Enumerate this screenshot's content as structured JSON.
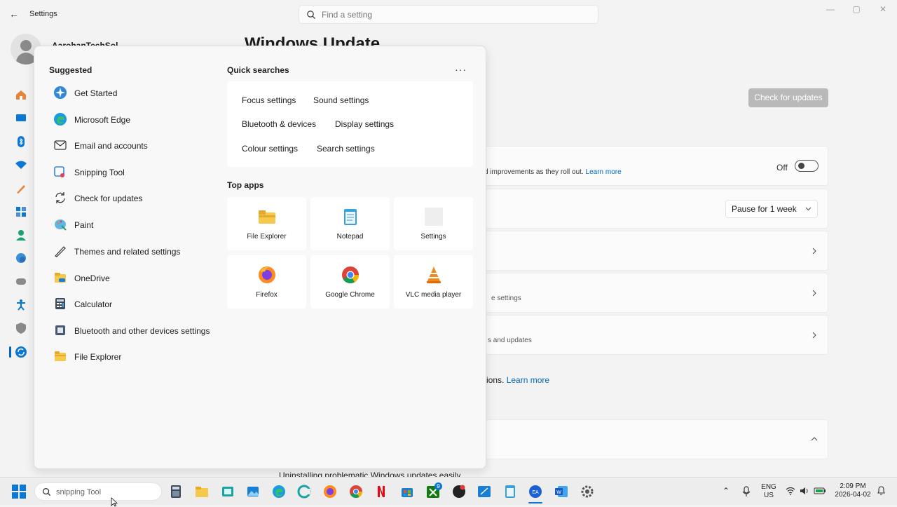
{
  "app": {
    "title": "Settings"
  },
  "search": {
    "placeholder": "Find a setting"
  },
  "account": {
    "name": "AarohanTechSol"
  },
  "page": {
    "title": "Windows Update"
  },
  "main": {
    "check_button": "Check for updates",
    "card1": {
      "text": "d improvements as they roll out.",
      "link": "Learn more",
      "toggle_label": "Off",
      "toggle_on": false
    },
    "pause_dropdown": "Pause for 1 week",
    "card4_text": "e settings",
    "card5_text": "s and updates",
    "help_text": "ions.",
    "help_link": "Learn more",
    "bottom_hint": "Uninstalling problematic Windows updates easily"
  },
  "panel": {
    "suggested_heading": "Suggested",
    "suggested": [
      {
        "label": "Get Started",
        "icon": "get-started-icon"
      },
      {
        "label": "Microsoft Edge",
        "icon": "edge-icon"
      },
      {
        "label": "Email and accounts",
        "icon": "mail-icon"
      },
      {
        "label": "Snipping Tool",
        "icon": "snipping-tool-icon"
      },
      {
        "label": "Check for updates",
        "icon": "refresh-icon"
      },
      {
        "label": "Paint",
        "icon": "paint-icon"
      },
      {
        "label": "Themes and related settings",
        "icon": "pen-icon"
      },
      {
        "label": "OneDrive",
        "icon": "onedrive-icon"
      },
      {
        "label": "Calculator",
        "icon": "calculator-icon"
      },
      {
        "label": "Bluetooth and other devices settings",
        "icon": "bluetooth-devices-icon"
      },
      {
        "label": "File Explorer",
        "icon": "folder-icon"
      }
    ],
    "quick_searches_heading": "Quick searches",
    "quick_searches": [
      "Focus settings",
      "Sound settings",
      "Bluetooth & devices",
      "Display settings",
      "Colour settings",
      "Search settings"
    ],
    "top_apps_heading": "Top apps",
    "top_apps": [
      {
        "label": "File Explorer",
        "icon": "folder-icon"
      },
      {
        "label": "Notepad",
        "icon": "notepad-icon"
      },
      {
        "label": "Settings",
        "icon": "settings-icon"
      },
      {
        "label": "Firefox",
        "icon": "firefox-icon"
      },
      {
        "label": "Google Chrome",
        "icon": "chrome-icon"
      },
      {
        "label": "VLC media player",
        "icon": "vlc-icon"
      }
    ]
  },
  "taskbar": {
    "search_value": "snipping Tool",
    "xbox_badge": "9",
    "lang_line1": "ENG",
    "lang_line2": "US",
    "time": "2:09 PM",
    "date": "2026-04-02"
  },
  "colors": {
    "accent": "#0067c0",
    "panel_bg": "#f8f8f8",
    "window_bg": "#f3f3f3"
  }
}
